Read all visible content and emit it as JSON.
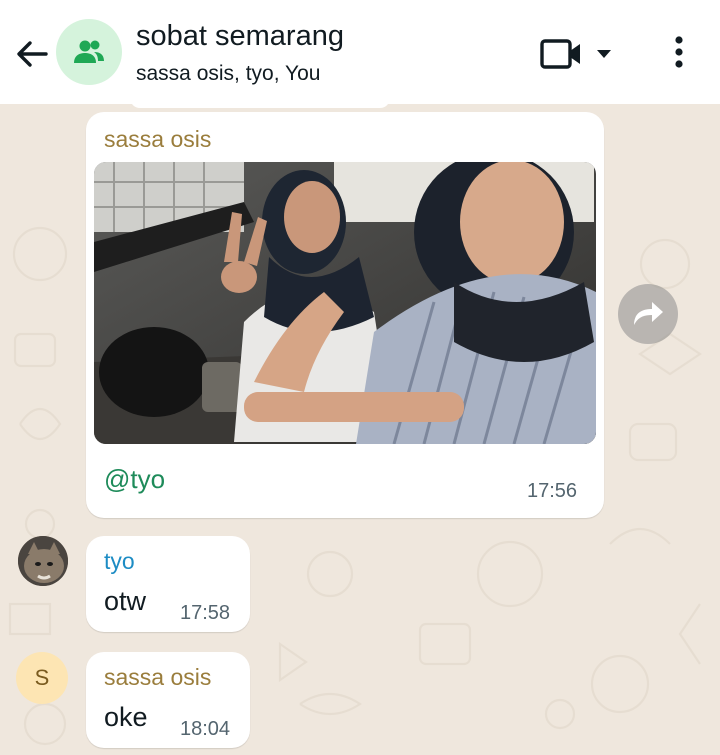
{
  "header": {
    "title": "sobat semarang",
    "subtitle": "sassa osis, tyo, You",
    "icons": [
      "back-arrow-icon",
      "group-icon",
      "video-call-icon",
      "dropdown-caret-icon",
      "more-vert-icon"
    ]
  },
  "messages": [
    {
      "sender": "sassa osis",
      "sender_color": "#9a7d3c",
      "type": "image",
      "caption": "@tyo",
      "caption_color": "#1e8b5a",
      "time": "17:56"
    },
    {
      "sender": "tyo",
      "sender_color": "#1d8cc4",
      "type": "text",
      "text": "otw",
      "time": "17:58"
    },
    {
      "sender": "sassa osis",
      "sender_color": "#9a7d3c",
      "type": "text",
      "text": "oke",
      "time": "18:04",
      "avatar_letter": "S"
    }
  ],
  "colors": {
    "chat_background": "#efe7dd",
    "bubble": "#ffffff",
    "header": "#ffffff",
    "group_avatar_bg": "#d5f3dc",
    "group_avatar_icon": "#1fa855"
  }
}
